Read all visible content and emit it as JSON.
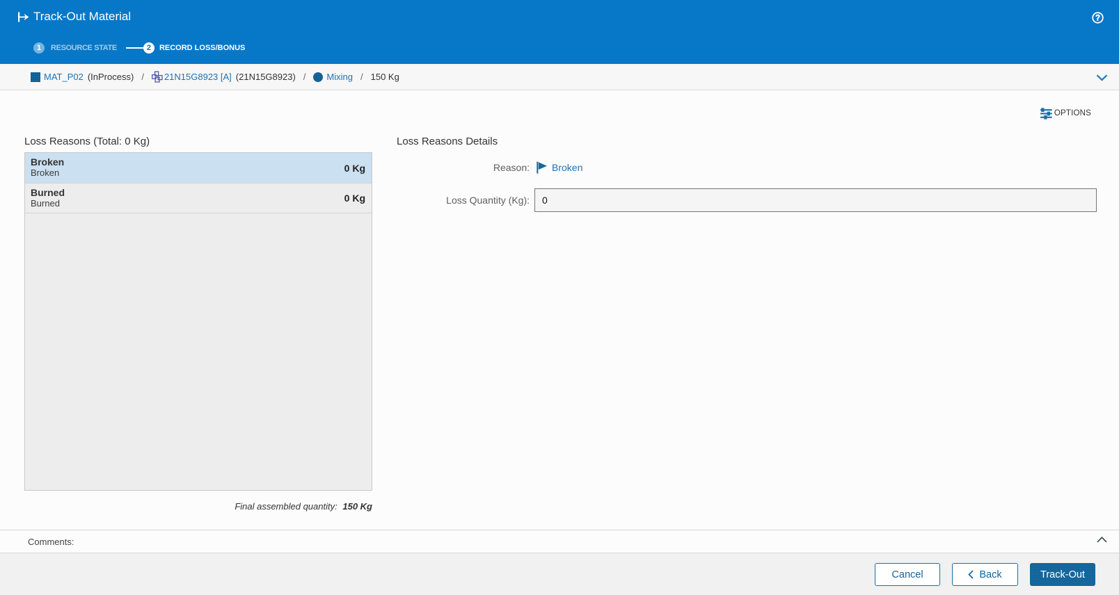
{
  "header": {
    "title": "Track-Out Material",
    "steps": [
      {
        "number": "1",
        "label": "RESOURCE STATE",
        "state": "done"
      },
      {
        "number": "2",
        "label": "RECORD LOSS/BONUS",
        "state": "active"
      }
    ]
  },
  "breadcrumb": {
    "separator": "/",
    "material_name": "MAT_P02",
    "material_status": "(InProcess)",
    "lot_name": "21N15G8923 [A]",
    "lot_id": "(21N15G8923)",
    "operation": "Mixing",
    "quantity": "150 Kg"
  },
  "toolbar": {
    "options_label": "OPTIONS"
  },
  "main": {
    "loss_reasons": {
      "title": "Loss Reasons (Total: 0 Kg)",
      "items": [
        {
          "name": "Broken",
          "description": "Broken",
          "quantity": "0 Kg",
          "selected": true
        },
        {
          "name": "Burned",
          "description": "Burned",
          "quantity": "0 Kg",
          "selected": false
        }
      ],
      "final_quantity_label": "Final assembled quantity:",
      "final_quantity_value": "150 Kg"
    },
    "details": {
      "title": "Loss Reasons Details",
      "reason_label": "Reason:",
      "reason_value": "Broken",
      "loss_quantity_label": "Loss Quantity (Kg):",
      "loss_quantity_value": "0"
    }
  },
  "comments": {
    "label": "Comments:"
  },
  "footer": {
    "cancel_label": "Cancel",
    "back_label": "Back",
    "track_out_label": "Track-Out"
  },
  "colors": {
    "header_blue": "#0778c8",
    "accent_blue": "#15689f",
    "link_blue": "#1b72b4",
    "selected_row": "#cbe0f1"
  }
}
